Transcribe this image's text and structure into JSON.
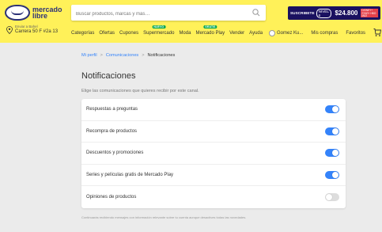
{
  "header": {
    "logo_text": "mercado libre",
    "search_placeholder": "Buscar productos, marcas y más…",
    "promo": {
      "subscribe_label": "SUSCRIBETE",
      "level_label": "NIVEL 6",
      "price": "$24.800",
      "tag_text": "DISNEY+ STAR+ HBO MAX PARAMOUNT"
    },
    "location": {
      "small": "Enviar a Bahel",
      "address": "Carrera 50 F #2a 13"
    },
    "nav": [
      "Categorías",
      "Ofertas",
      "Cupones",
      "Supermercado",
      "Moda",
      "Mercado Play",
      "Vender",
      "Ayuda"
    ],
    "nav_badges": {
      "Supermercado": "NUEVO",
      "Mercado Play": "GRATIS"
    },
    "user": [
      "Gomez Ku...",
      "Mis compras",
      "Favoritos"
    ]
  },
  "breadcrumb": {
    "items": [
      "Mi perfil",
      "Comunicaciones",
      "Notificaciones"
    ],
    "separator": ">"
  },
  "page": {
    "title": "Notificaciones",
    "subtitle": "Elige las comunicaciones que quieres recibir por este canal."
  },
  "notifications": [
    {
      "label": "Respuestas a preguntas",
      "enabled": true
    },
    {
      "label": "Recompra de productos",
      "enabled": true
    },
    {
      "label": "Descuentos y promociones",
      "enabled": true
    },
    {
      "label": "Series y películas gratis de Mercado Play",
      "enabled": true
    },
    {
      "label": "Opiniones de productos",
      "enabled": false
    }
  ],
  "footer_note": "Continuarás recibiendo mensajes con información relevante sobre tu cuenta aunque desactives todas las novedades.",
  "colors": {
    "header_bg": "#fff159",
    "toggle_on": "#3483fa",
    "toggle_off": "#dddddd",
    "page_bg": "#ebebeb"
  }
}
